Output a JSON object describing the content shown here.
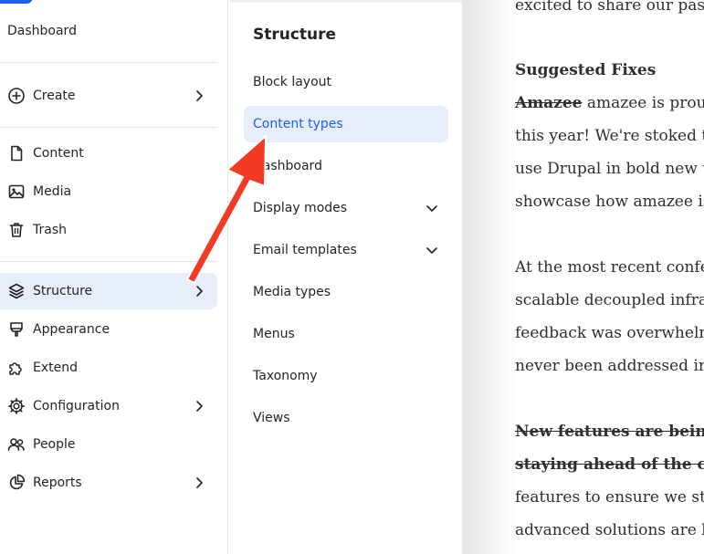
{
  "sidebar": {
    "dashboard": "Dashboard",
    "create": "Create",
    "content": "Content",
    "media": "Media",
    "trash": "Trash",
    "structure": "Structure",
    "appearance": "Appearance",
    "extend": "Extend",
    "configuration": "Configuration",
    "people": "People",
    "reports": "Reports"
  },
  "flyout": {
    "title": "Structure",
    "items": [
      "Block layout",
      "Content types",
      "Dashboard",
      "Display modes",
      "Email templates",
      "Media types",
      "Menus",
      "Taxonomy",
      "Views"
    ]
  },
  "content": {
    "lines": [
      "excited to share our pass",
      "Suggested Fixes",
      "Amazee",
      " amazee is proud",
      "this year! We're stoked to",
      "use Drupal in bold new w",
      "showcase how amazee is",
      "At the most recent confe",
      "scalable decoupled infras",
      "feedback was overwhelm",
      "never been addressed in",
      "New features are being r",
      "staying ahead of the com",
      "features to ensure we sta",
      "advanced solutions are b"
    ]
  },
  "colors": {
    "accent": "#1f5ff0",
    "active_bg": "#e7edfb",
    "annotation_arrow": "#f23a25"
  }
}
